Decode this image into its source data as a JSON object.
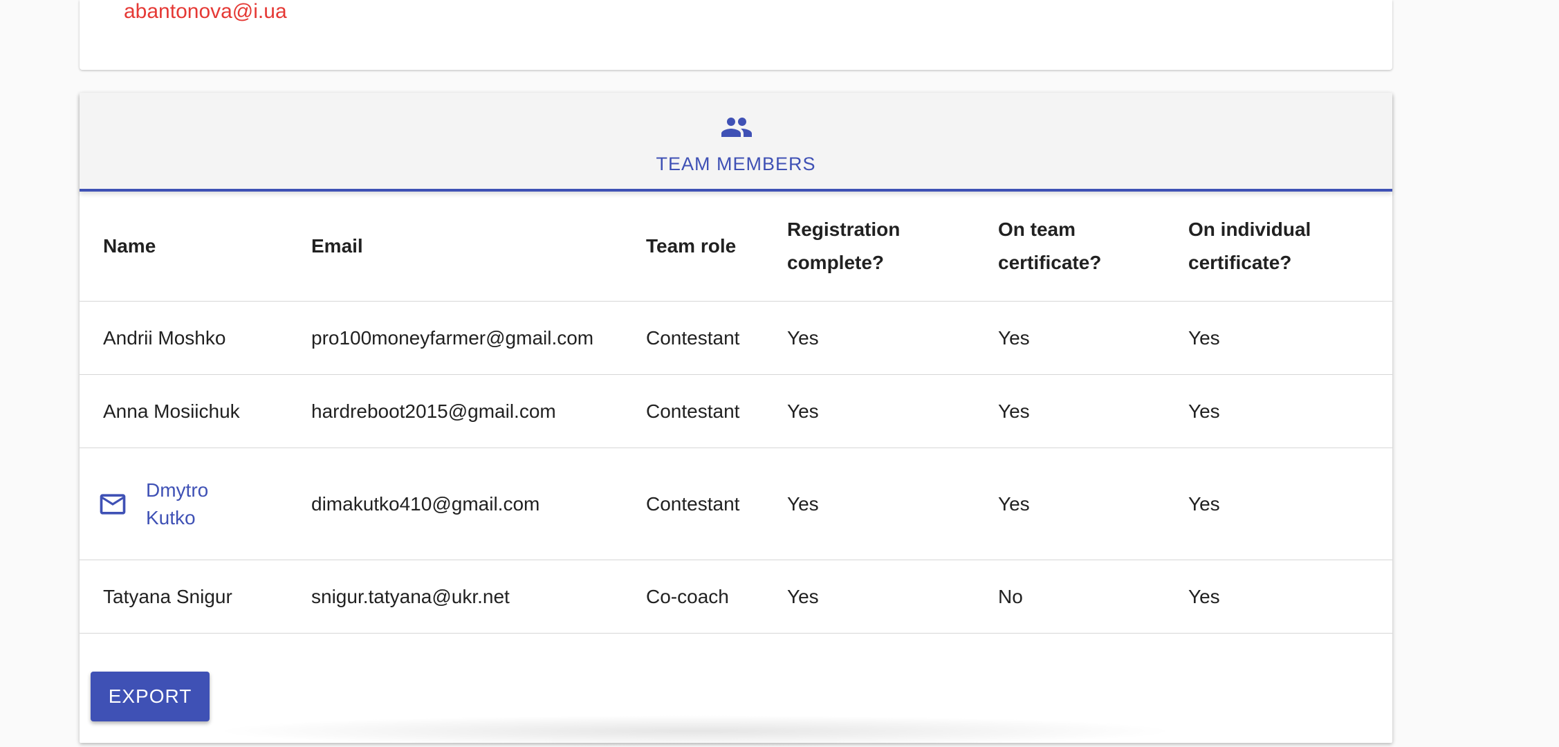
{
  "top_card": {
    "email": "abantonova@i.ua"
  },
  "team_section": {
    "tab_label": "TEAM MEMBERS",
    "tab_icon": "people-icon",
    "accent_color": "#3f51b5",
    "columns": {
      "name": "Name",
      "email": "Email",
      "role": "Team role",
      "registration_line1": "Registration",
      "registration_line2": "complete?",
      "team_cert_line1": "On team",
      "team_cert_line2": "certificate?",
      "individual_cert_line1": "On individual",
      "individual_cert_line2": "certificate?"
    },
    "members": [
      {
        "name": "Andrii Moshko",
        "email": "pro100moneyfarmer@gmail.com",
        "role": "Contestant",
        "registration_complete": "Yes",
        "on_team_certificate": "Yes",
        "on_individual_certificate": "Yes"
      },
      {
        "name": "Anna Mosiichuk",
        "email": "hardreboot2015@gmail.com",
        "role": "Contestant",
        "registration_complete": "Yes",
        "on_team_certificate": "Yes",
        "on_individual_certificate": "Yes"
      },
      {
        "name": "Dmytro Kutko",
        "name_icon": "mail-icon",
        "email": "dimakutko410@gmail.com",
        "role": "Contestant",
        "registration_complete": "Yes",
        "on_team_certificate": "Yes",
        "on_individual_certificate": "Yes"
      },
      {
        "name": "Tatyana Snigur",
        "email": "snigur.tatyana@ukr.net",
        "role": "Co-coach",
        "registration_complete": "Yes",
        "on_team_certificate": "No",
        "on_individual_certificate": "Yes"
      }
    ],
    "export_label": "EXPORT"
  }
}
